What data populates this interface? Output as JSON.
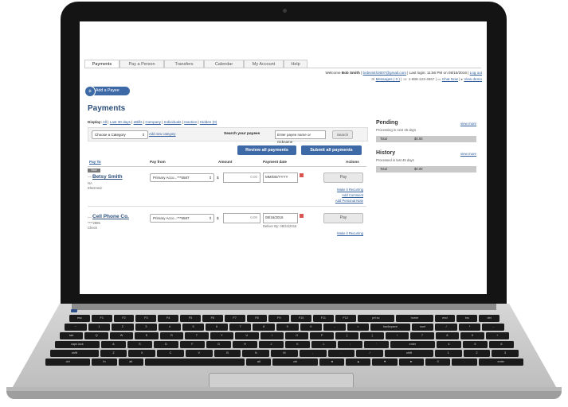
{
  "tabs": [
    "Payments",
    "Pay a Person",
    "Transfers",
    "Calendar",
    "My Account",
    "Help"
  ],
  "header": {
    "welcome_prefix": "Welcome",
    "user_name": "Bob Smith",
    "email": "bobsmith3007@gmail.com",
    "last_login": "Last login: 11:56 PM on 08/15/2016",
    "logout": "Log out",
    "messages": "Messages ( 0 )",
    "phone": "1-888-123-4567",
    "chat": "Chat Now",
    "view_demo": "View demo"
  },
  "add_payee_label": "Add a Payee",
  "page_title": "Payments",
  "display": {
    "prefix": "Display:",
    "options": [
      "All",
      "Last 30 days",
      "eBills",
      "Company",
      "Individuals",
      "Inactive",
      "Hidden (0)"
    ]
  },
  "filter": {
    "category_value": "Choose a Category",
    "add_category": "Add new category",
    "search_label": "Search your payees",
    "search_placeholder": "Enter payee name or nickname",
    "search_button": "Search"
  },
  "review_button": "Review all payments",
  "submit_button": "Submit all payments",
  "columns": [
    "Pay To",
    "Pay from",
    "Amount",
    "Payment date",
    "Actions"
  ],
  "payees": [
    {
      "badge": "New",
      "name": "Betsy Smith",
      "line1": "NA",
      "line2": "Electronic",
      "account": "Primary Acco...***5587",
      "currency": "$",
      "amount": "0.00",
      "date": "MM/DD/YYYY",
      "deliver_by": "",
      "pay": "Pay",
      "links": [
        "Make it Recurring",
        "Add Comment",
        "Add Personal Note"
      ]
    },
    {
      "badge": "",
      "name": "Cell Phone Co.",
      "line1": "****2895",
      "line2": "Check",
      "account": "Primary Acco...***5587",
      "currency": "$",
      "amount": "0.00",
      "date": "08/16/2016",
      "deliver_by": "Deliver By: 08/24/2016",
      "pay": "Pay",
      "links": [
        "Make it Recurring"
      ]
    }
  ],
  "sidebar": {
    "pending": {
      "title": "Pending",
      "subtitle": "Processing in next 45 days",
      "link": "view more",
      "total_label": "Total",
      "total_value": "$0.00"
    },
    "history": {
      "title": "History",
      "subtitle": "Processed in last 45 days",
      "link": "view more",
      "total_label": "Total",
      "total_value": "$0.00"
    }
  },
  "keyboard_rows": [
    [
      "esc",
      "F1",
      "F2",
      "F3",
      "F4",
      "F5",
      "F6",
      "F7",
      "F8",
      "F9",
      "F10",
      "F11",
      "F12",
      "prt sc",
      "home",
      "end",
      "ins",
      "del"
    ],
    [
      "~",
      "1",
      "2",
      "3",
      "4",
      "5",
      "6",
      "7",
      "8",
      "9",
      "0",
      "-",
      "=",
      "backspace",
      "num",
      "/",
      "*",
      "-"
    ],
    [
      "tab",
      "Q",
      "W",
      "E",
      "R",
      "T",
      "Y",
      "U",
      "I",
      "O",
      "P",
      "[",
      "]",
      "\\",
      "7",
      "8",
      "9",
      "+"
    ],
    [
      "caps lock",
      "A",
      "S",
      "D",
      "F",
      "G",
      "H",
      "J",
      "K",
      "L",
      ";",
      "'",
      "enter",
      "4",
      "5",
      "6"
    ],
    [
      "shift",
      "Z",
      "X",
      "C",
      "V",
      "B",
      "N",
      "M",
      ",",
      ".",
      "/",
      "shift",
      "1",
      "2",
      "3"
    ],
    [
      "ctrl",
      "fn",
      "alt",
      "",
      "alt",
      "ctrl",
      "◄",
      "▲",
      "▼",
      "►",
      "0",
      ".",
      "enter"
    ]
  ]
}
